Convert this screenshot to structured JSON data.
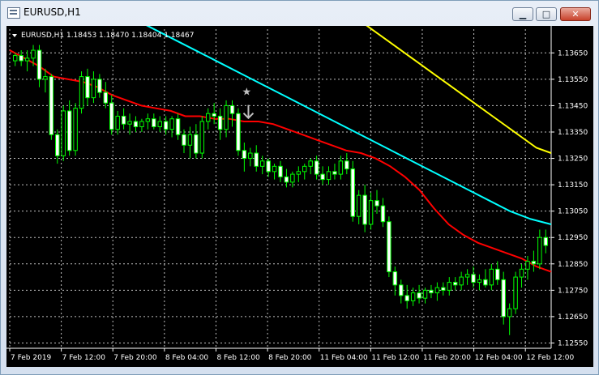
{
  "window": {
    "title": "EURUSD,H1"
  },
  "chart_data": {
    "type": "candlestick",
    "header": {
      "symbol": "EURUSD,H1",
      "bid_open": "1.18453",
      "high": "1.18470",
      "low": "1.18404",
      "close": "1.18467"
    },
    "y_ticks": [
      "1.13650",
      "1.13550",
      "1.13450",
      "1.13350",
      "1.13250",
      "1.13150",
      "1.13050",
      "1.12950",
      "1.12850",
      "1.12750",
      "1.12650",
      "1.12550"
    ],
    "x_ticks": [
      "7 Feb 2019",
      "7 Feb 12:00",
      "7 Feb 20:00",
      "8 Feb 04:00",
      "8 Feb 12:00",
      "8 Feb 20:00",
      "11 Feb 04:00",
      "11 Feb 12:00",
      "11 Feb 20:00",
      "12 Feb 04:00",
      "12 Feb 12:00"
    ],
    "ylim": [
      1.1253,
      1.1374
    ],
    "grid": true,
    "colors": {
      "background": "#000000",
      "grid": "#c0c0c0",
      "candle_up": "#00ff00",
      "candle_body": "#ffffff",
      "ma_fast": "#ff0000",
      "ma_mid": "#00ffff",
      "ma_slow": "#ffff00"
    },
    "candles": [
      [
        1.1362,
        1.1365,
        1.136,
        1.1364
      ],
      [
        1.1364,
        1.1366,
        1.136,
        1.1362
      ],
      [
        1.1362,
        1.1366,
        1.1358,
        1.1363
      ],
      [
        1.1363,
        1.1368,
        1.136,
        1.1366
      ],
      [
        1.1366,
        1.1368,
        1.1352,
        1.1355
      ],
      [
        1.1355,
        1.1359,
        1.135,
        1.1356
      ],
      [
        1.1356,
        1.1357,
        1.1332,
        1.1334
      ],
      [
        1.1334,
        1.1336,
        1.1323,
        1.1326
      ],
      [
        1.1326,
        1.1345,
        1.1324,
        1.1343
      ],
      [
        1.1343,
        1.1347,
        1.1326,
        1.1328
      ],
      [
        1.1328,
        1.1346,
        1.1326,
        1.1344
      ],
      [
        1.1344,
        1.1358,
        1.1342,
        1.1356
      ],
      [
        1.1356,
        1.1359,
        1.1345,
        1.1348
      ],
      [
        1.1348,
        1.1358,
        1.1346,
        1.1355
      ],
      [
        1.1355,
        1.1357,
        1.1348,
        1.135
      ],
      [
        1.135,
        1.1354,
        1.1344,
        1.1346
      ],
      [
        1.1346,
        1.1349,
        1.1334,
        1.1336
      ],
      [
        1.1336,
        1.1343,
        1.1334,
        1.1341
      ],
      [
        1.1341,
        1.1344,
        1.1336,
        1.1338
      ],
      [
        1.1338,
        1.1342,
        1.1334,
        1.1339
      ],
      [
        1.1339,
        1.1341,
        1.1335,
        1.1337
      ],
      [
        1.1337,
        1.134,
        1.1335,
        1.1339
      ],
      [
        1.1339,
        1.1342,
        1.1336,
        1.134
      ],
      [
        1.134,
        1.1342,
        1.1336,
        1.1337
      ],
      [
        1.1337,
        1.1341,
        1.1335,
        1.1339
      ],
      [
        1.1339,
        1.1341,
        1.1334,
        1.1336
      ],
      [
        1.1336,
        1.1341,
        1.1333,
        1.134
      ],
      [
        1.134,
        1.1342,
        1.1332,
        1.1334
      ],
      [
        1.1334,
        1.1336,
        1.1327,
        1.133
      ],
      [
        1.133,
        1.1337,
        1.1325,
        1.1334
      ],
      [
        1.1334,
        1.1338,
        1.1325,
        1.1327
      ],
      [
        1.1327,
        1.1341,
        1.1325,
        1.1339
      ],
      [
        1.1339,
        1.1344,
        1.1336,
        1.1342
      ],
      [
        1.1342,
        1.1346,
        1.1338,
        1.1341
      ],
      [
        1.1341,
        1.1344,
        1.1332,
        1.1336
      ],
      [
        1.1336,
        1.1347,
        1.1333,
        1.1345
      ],
      [
        1.1345,
        1.1347,
        1.1337,
        1.1342
      ],
      [
        1.1342,
        1.1344,
        1.1326,
        1.1328
      ],
      [
        1.1328,
        1.1331,
        1.132,
        1.1325
      ],
      [
        1.1325,
        1.1329,
        1.1322,
        1.1327
      ],
      [
        1.1327,
        1.133,
        1.132,
        1.1322
      ],
      [
        1.1322,
        1.1326,
        1.1319,
        1.1324
      ],
      [
        1.1324,
        1.1325,
        1.1318,
        1.132
      ],
      [
        1.132,
        1.1323,
        1.1317,
        1.1322
      ],
      [
        1.1322,
        1.1324,
        1.1316,
        1.1318
      ],
      [
        1.1318,
        1.1321,
        1.1314,
        1.1316
      ],
      [
        1.1316,
        1.132,
        1.1314,
        1.1319
      ],
      [
        1.1319,
        1.1322,
        1.1316,
        1.132
      ],
      [
        1.132,
        1.1323,
        1.1317,
        1.1322
      ],
      [
        1.1322,
        1.1325,
        1.1319,
        1.1324
      ],
      [
        1.1324,
        1.1326,
        1.1317,
        1.1319
      ],
      [
        1.1319,
        1.1322,
        1.1315,
        1.1317
      ],
      [
        1.1317,
        1.1322,
        1.1315,
        1.132
      ],
      [
        1.132,
        1.1323,
        1.1317,
        1.1319
      ],
      [
        1.1319,
        1.1326,
        1.1317,
        1.1324
      ],
      [
        1.1324,
        1.1327,
        1.1319,
        1.1321
      ],
      [
        1.1321,
        1.1324,
        1.1301,
        1.1303
      ],
      [
        1.1303,
        1.1313,
        1.13,
        1.1311
      ],
      [
        1.1311,
        1.1315,
        1.1297,
        1.13
      ],
      [
        1.13,
        1.1312,
        1.1298,
        1.1309
      ],
      [
        1.1309,
        1.1313,
        1.1304,
        1.1307
      ],
      [
        1.1307,
        1.131,
        1.1299,
        1.1301
      ],
      [
        1.1301,
        1.1303,
        1.128,
        1.1282
      ],
      [
        1.1282,
        1.1284,
        1.1273,
        1.1277
      ],
      [
        1.1277,
        1.1279,
        1.127,
        1.1273
      ],
      [
        1.1273,
        1.1277,
        1.1268,
        1.1271
      ],
      [
        1.1271,
        1.1276,
        1.1269,
        1.1274
      ],
      [
        1.1274,
        1.1277,
        1.127,
        1.1272
      ],
      [
        1.1272,
        1.1276,
        1.127,
        1.1275
      ],
      [
        1.1275,
        1.1277,
        1.1272,
        1.1274
      ],
      [
        1.1274,
        1.1278,
        1.1271,
        1.1276
      ],
      [
        1.1276,
        1.1278,
        1.1273,
        1.1275
      ],
      [
        1.1275,
        1.128,
        1.1273,
        1.1278
      ],
      [
        1.1278,
        1.128,
        1.1275,
        1.1277
      ],
      [
        1.1277,
        1.1282,
        1.1275,
        1.128
      ],
      [
        1.128,
        1.1283,
        1.1277,
        1.1281
      ],
      [
        1.1281,
        1.1284,
        1.1276,
        1.1278
      ],
      [
        1.1278,
        1.1281,
        1.1275,
        1.1279
      ],
      [
        1.1279,
        1.1283,
        1.1276,
        1.1277
      ],
      [
        1.1277,
        1.1285,
        1.1275,
        1.1283
      ],
      [
        1.1283,
        1.1286,
        1.1277,
        1.1279
      ],
      [
        1.1279,
        1.1282,
        1.1262,
        1.1265
      ],
      [
        1.1265,
        1.127,
        1.1258,
        1.1268
      ],
      [
        1.1268,
        1.1282,
        1.1266,
        1.128
      ],
      [
        1.128,
        1.1285,
        1.1276,
        1.1283
      ],
      [
        1.1283,
        1.1288,
        1.1279,
        1.1286
      ],
      [
        1.1286,
        1.129,
        1.1282,
        1.1285
      ],
      [
        1.1285,
        1.1298,
        1.1283,
        1.1295
      ],
      [
        1.1295,
        1.1298,
        1.1289,
        1.1292
      ]
    ],
    "ma_fast": [
      1.1366,
      1.1363,
      1.136,
      1.1356,
      1.1355,
      1.1354,
      1.1352,
      1.1349,
      1.1347,
      1.1345,
      1.1344,
      1.1343,
      1.1341,
      1.1341,
      1.134,
      1.134,
      1.1339,
      1.1339,
      1.1338,
      1.1336,
      1.1334,
      1.1332,
      1.133,
      1.1328,
      1.1327,
      1.1325,
      1.1322,
      1.1318,
      1.1313,
      1.1306,
      1.13,
      1.1296,
      1.1293,
      1.1291,
      1.1289,
      1.1287,
      1.1284,
      1.1282
    ],
    "ma_mid": [
      1.138,
      1.1377,
      1.1373,
      1.1369,
      1.1365,
      1.1361,
      1.1357,
      1.1353,
      1.1349,
      1.1345,
      1.1341,
      1.1337,
      1.1333,
      1.1329,
      1.1325,
      1.1321,
      1.1317,
      1.1313,
      1.1309,
      1.1305,
      1.1302,
      1.13
    ],
    "ma_slow": [
      1.1391,
      1.1388,
      1.1385,
      1.1381,
      1.1377,
      1.1373,
      1.1369,
      1.1365,
      1.1361,
      1.1357,
      1.1353,
      1.1349,
      1.1345,
      1.1341,
      1.1337,
      1.1333,
      1.1329,
      1.1327
    ]
  }
}
